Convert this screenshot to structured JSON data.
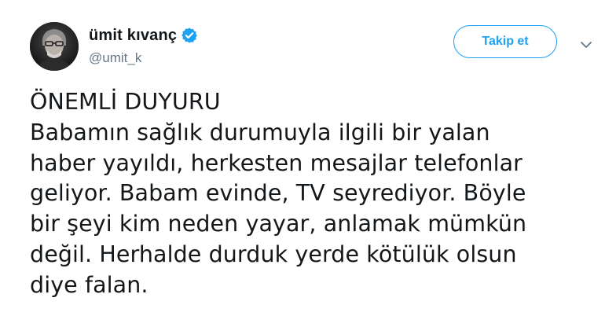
{
  "author": {
    "display_name": "ümit kıvanç",
    "handle": "@umit_k",
    "verified_icon": "verified-badge-icon"
  },
  "actions": {
    "follow_label": "Takip et",
    "more_icon": "chevron-down-icon"
  },
  "tweet": {
    "lines": [
      "ÖNEMLİ DUYURU",
      "Babamın sağlık durumuyla ilgili bir yalan",
      "haber yayıldı, herkesten mesajlar telefonlar",
      "geliyor. Babam evinde, TV seyrediyor. Böyle",
      "bir şeyi kim neden yayar, anlamak mümkün",
      "değil. Herhalde durduk yerde kötülük olsun",
      "diye falan."
    ]
  },
  "colors": {
    "accent": "#1da1f2",
    "text": "#14171a",
    "secondary": "#657786"
  }
}
